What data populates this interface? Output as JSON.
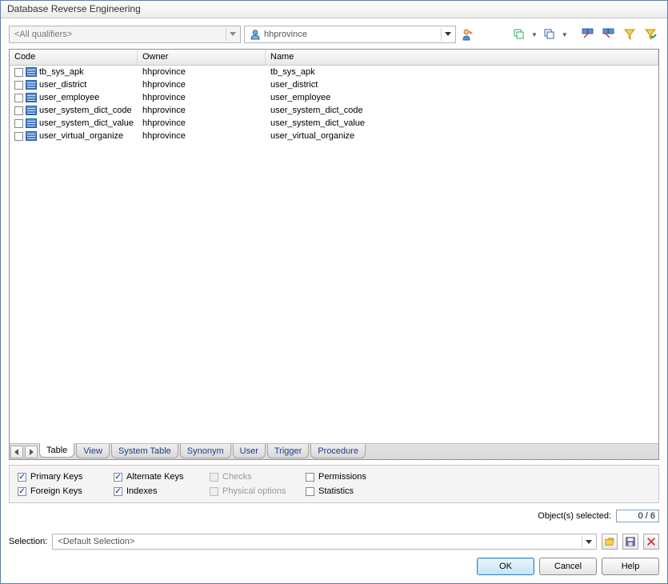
{
  "window": {
    "title": "Database Reverse Engineering"
  },
  "toolbar": {
    "qualifier_placeholder": "<All qualifiers>",
    "owner_value": "hhprovince"
  },
  "columns": {
    "code": "Code",
    "owner": "Owner",
    "name": "Name"
  },
  "rows": [
    {
      "code": "tb_sys_apk",
      "owner": "hhprovince",
      "name": "tb_sys_apk"
    },
    {
      "code": "user_district",
      "owner": "hhprovince",
      "name": "user_district"
    },
    {
      "code": "user_employee",
      "owner": "hhprovince",
      "name": "user_employee"
    },
    {
      "code": "user_system_dict_code",
      "owner": "hhprovince",
      "name": "user_system_dict_code"
    },
    {
      "code": "user_system_dict_value",
      "owner": "hhprovince",
      "name": "user_system_dict_value"
    },
    {
      "code": "user_virtual_organize",
      "owner": "hhprovince",
      "name": "user_virtual_organize"
    }
  ],
  "tabs": [
    "Table",
    "View",
    "System Table",
    "Synonym",
    "User",
    "Trigger",
    "Procedure"
  ],
  "options": {
    "primary_keys": "Primary Keys",
    "foreign_keys": "Foreign Keys",
    "alternate_keys": "Alternate Keys",
    "indexes": "Indexes",
    "checks": "Checks",
    "physical_options": "Physical options",
    "permissions": "Permissions",
    "statistics": "Statistics"
  },
  "selected": {
    "label": "Object(s) selected:",
    "count": "0 / 6"
  },
  "selection": {
    "label": "Selection:",
    "value": "<Default Selection>"
  },
  "buttons": {
    "ok": "OK",
    "cancel": "Cancel",
    "help": "Help"
  }
}
